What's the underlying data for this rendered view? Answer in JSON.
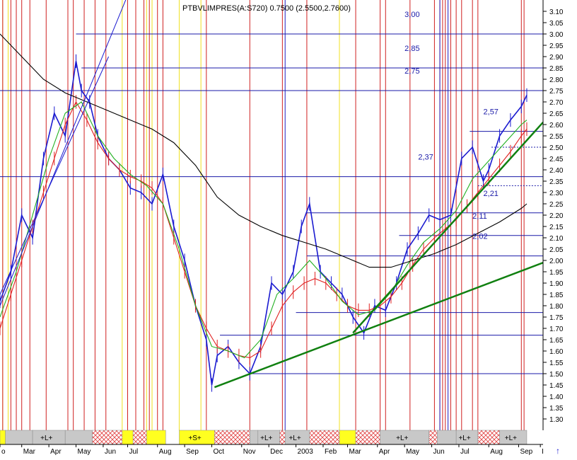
{
  "chart_data": {
    "type": "line",
    "title": "PTBVLIMPRES(A:S720) 0.7500 (2.5500,2.7600)",
    "y_ticks": [
      "3.10",
      "3.05",
      "3.00",
      "2.95",
      "2.90",
      "2.85",
      "2.80",
      "2.75",
      "2.70",
      "2.65",
      "2.60",
      "2.55",
      "2.50",
      "2.45",
      "2.40",
      "2.35",
      "2.30",
      "2.25",
      "2.20",
      "2.15",
      "2.10",
      "2.05",
      "2.00",
      "1.95",
      "1.90",
      "1.85",
      "1.80",
      "1.75",
      "1.70",
      "1.65",
      "1.60",
      "1.55",
      "1.50",
      "1.45",
      "1.40",
      "1.35",
      "1.30"
    ],
    "ylim": [
      1.25,
      3.15
    ],
    "x_range": [
      0,
      1.0
    ],
    "x_labels": [
      {
        "label": "o",
        "x": 0.0
      },
      {
        "label": "Mar",
        "x": 0.04
      },
      {
        "label": "Apr",
        "x": 0.09
      },
      {
        "label": "May",
        "x": 0.14
      },
      {
        "label": "Jun",
        "x": 0.19
      },
      {
        "label": "Jul",
        "x": 0.235
      },
      {
        "label": "Aug",
        "x": 0.29
      },
      {
        "label": "Sep",
        "x": 0.34
      },
      {
        "label": "Oct",
        "x": 0.39
      },
      {
        "label": "Nov",
        "x": 0.445
      },
      {
        "label": "Dec",
        "x": 0.495
      },
      {
        "label": "2003",
        "x": 0.545
      },
      {
        "label": "Feb",
        "x": 0.595
      },
      {
        "label": "Mar",
        "x": 0.64
      },
      {
        "label": "Apr",
        "x": 0.695
      },
      {
        "label": "May",
        "x": 0.745
      },
      {
        "label": "Jun",
        "x": 0.795
      },
      {
        "label": "Jul",
        "x": 0.845
      },
      {
        "label": "Aug",
        "x": 0.9
      },
      {
        "label": "Sep",
        "x": 0.955
      },
      {
        "label": "I",
        "x": 0.995
      }
    ],
    "price_levels": [
      {
        "label": "3,00",
        "y": 3.0,
        "x_from": 0.14,
        "label_x": 0.745
      },
      {
        "label": "2,85",
        "y": 2.85,
        "x_from": 0.15,
        "label_x": 0.745
      },
      {
        "label": "2,75",
        "y": 2.75,
        "x_from": 0.0,
        "label_x": 0.745
      },
      {
        "label": "2,57",
        "y": 2.57,
        "x_from": 0.865,
        "label_x": 0.89
      },
      {
        "label": "2,37",
        "y": 2.37,
        "x_from": 0.0,
        "label_x": 0.77
      },
      {
        "label": "2,21",
        "y": 2.21,
        "x_from": 0.565,
        "label_x": 0.89
      },
      {
        "label": "2,11",
        "y": 2.11,
        "x_from": 0.735,
        "label_x": 0.87
      },
      {
        "label": "2,02",
        "y": 2.02,
        "x_from": 0.565,
        "label_x": 0.87
      },
      {
        "label": "",
        "y": 1.77,
        "x_from": 0.545,
        "label_x": 0
      },
      {
        "label": "",
        "y": 1.67,
        "x_from": 0.405,
        "label_x": 0
      },
      {
        "label": "",
        "y": 1.5,
        "x_from": 0.46,
        "label_x": 0
      }
    ],
    "dotted_levels": [
      {
        "y": 2.5,
        "x_from": 0.905
      },
      {
        "y": 2.33,
        "x_from": 0.88
      }
    ],
    "trendlines": [
      {
        "name": "green-upper",
        "color": "#108010",
        "x1": 0.65,
        "y1": 1.68,
        "x2": 1.0,
        "y2": 2.61
      },
      {
        "name": "green-lower",
        "color": "#108010",
        "x1": 0.395,
        "y1": 1.44,
        "x2": 1.0,
        "y2": 1.99
      },
      {
        "name": "blue-steep-1",
        "color": "#1a1ad0",
        "x1": 0.0,
        "y1": 1.8,
        "x2": 0.24,
        "y2": 3.2
      },
      {
        "name": "blue-steep-2",
        "color": "#1a1ad0",
        "x1": 0.0,
        "y1": 1.85,
        "x2": 0.2,
        "y2": 2.9
      }
    ],
    "series": [
      {
        "name": "",
        "color": "#1a1ad0",
        "x": [
          0.0,
          0.02,
          0.04,
          0.06,
          0.08,
          0.1,
          0.12,
          0.14,
          0.15,
          0.165,
          0.18,
          0.2,
          0.22,
          0.24,
          0.26,
          0.28,
          0.3,
          0.32,
          0.34,
          0.36,
          0.38,
          0.39,
          0.4,
          0.42,
          0.44,
          0.46,
          0.48,
          0.5,
          0.52,
          0.54,
          0.555,
          0.57,
          0.59,
          0.61,
          0.63,
          0.65,
          0.67,
          0.69,
          0.71,
          0.73,
          0.75,
          0.77,
          0.79,
          0.81,
          0.83,
          0.85,
          0.87,
          0.89,
          0.9,
          0.92,
          0.94,
          0.96,
          0.97
        ],
        "y": [
          1.82,
          1.95,
          2.2,
          2.1,
          2.45,
          2.65,
          2.55,
          2.88,
          2.75,
          2.7,
          2.55,
          2.45,
          2.4,
          2.32,
          2.3,
          2.25,
          2.38,
          2.15,
          2.0,
          1.8,
          1.65,
          1.45,
          1.58,
          1.62,
          1.55,
          1.5,
          1.62,
          1.9,
          1.85,
          1.95,
          2.15,
          2.25,
          1.95,
          1.9,
          1.85,
          1.75,
          1.68,
          1.8,
          1.78,
          1.9,
          2.05,
          2.12,
          2.2,
          2.18,
          2.2,
          2.45,
          2.5,
          2.35,
          2.4,
          2.55,
          2.62,
          2.68,
          2.73
        ]
      },
      {
        "name": "",
        "color": "#e02020",
        "x": [
          0.0,
          0.02,
          0.04,
          0.06,
          0.08,
          0.1,
          0.12,
          0.14,
          0.16,
          0.18,
          0.2,
          0.22,
          0.24,
          0.26,
          0.28,
          0.3,
          0.32,
          0.34,
          0.36,
          0.38,
          0.4,
          0.42,
          0.44,
          0.46,
          0.48,
          0.5,
          0.52,
          0.54,
          0.56,
          0.58,
          0.6,
          0.62,
          0.64,
          0.66,
          0.68,
          0.7,
          0.72,
          0.74,
          0.76,
          0.78,
          0.8,
          0.82,
          0.84,
          0.86,
          0.88,
          0.9,
          0.92,
          0.94,
          0.96,
          0.97
        ],
        "y": [
          1.7,
          1.85,
          2.0,
          2.15,
          2.3,
          2.45,
          2.6,
          2.7,
          2.62,
          2.52,
          2.45,
          2.4,
          2.37,
          2.35,
          2.32,
          2.25,
          2.1,
          1.95,
          1.8,
          1.7,
          1.62,
          1.6,
          1.58,
          1.57,
          1.6,
          1.7,
          1.8,
          1.86,
          1.9,
          1.92,
          1.9,
          1.85,
          1.8,
          1.78,
          1.78,
          1.8,
          1.84,
          1.9,
          1.98,
          2.05,
          2.1,
          2.14,
          2.18,
          2.24,
          2.3,
          2.36,
          2.42,
          2.48,
          2.55,
          2.58
        ]
      },
      {
        "name": "",
        "color": "#20b020",
        "x": [
          0.0,
          0.03,
          0.06,
          0.09,
          0.12,
          0.15,
          0.18,
          0.21,
          0.24,
          0.27,
          0.3,
          0.33,
          0.36,
          0.39,
          0.42,
          0.45,
          0.48,
          0.51,
          0.54,
          0.57,
          0.6,
          0.63,
          0.66,
          0.69,
          0.72,
          0.75,
          0.78,
          0.81,
          0.84,
          0.87,
          0.9,
          0.93,
          0.96,
          0.97
        ],
        "y": [
          1.75,
          1.95,
          2.2,
          2.45,
          2.65,
          2.7,
          2.55,
          2.45,
          2.38,
          2.33,
          2.25,
          2.05,
          1.8,
          1.62,
          1.6,
          1.57,
          1.65,
          1.85,
          1.92,
          2.0,
          1.92,
          1.82,
          1.76,
          1.78,
          1.86,
          1.98,
          2.08,
          2.14,
          2.22,
          2.36,
          2.44,
          2.52,
          2.6,
          2.62
        ]
      },
      {
        "name": "",
        "color": "#000000",
        "x": [
          0.0,
          0.04,
          0.08,
          0.12,
          0.16,
          0.2,
          0.24,
          0.28,
          0.32,
          0.36,
          0.4,
          0.44,
          0.48,
          0.52,
          0.56,
          0.6,
          0.64,
          0.68,
          0.72,
          0.76,
          0.8,
          0.84,
          0.88,
          0.92,
          0.96,
          0.97
        ],
        "y": [
          3.0,
          2.9,
          2.8,
          2.74,
          2.7,
          2.66,
          2.62,
          2.58,
          2.52,
          2.42,
          2.28,
          2.2,
          2.15,
          2.11,
          2.08,
          2.05,
          2.01,
          1.97,
          1.97,
          2.0,
          2.03,
          2.07,
          2.12,
          2.17,
          2.23,
          2.25
        ]
      }
    ],
    "red_vlines": [
      0.005,
      0.02,
      0.03,
      0.04,
      0.055,
      0.085,
      0.125,
      0.135,
      0.155,
      0.175,
      0.195,
      0.235,
      0.25,
      0.265,
      0.275,
      0.29,
      0.3,
      0.38,
      0.46,
      0.52,
      0.565,
      0.655,
      0.7,
      0.71,
      0.755,
      0.8,
      0.81,
      0.815,
      0.82,
      0.83,
      0.84,
      0.85,
      0.87,
      0.88,
      0.96,
      0.965
    ],
    "yellow_vlines": [
      0.005,
      0.015,
      0.225,
      0.27,
      0.28,
      0.33,
      0.37,
      0.625
    ],
    "blue_vlines": [
      0.525,
      0.81,
      0.825
    ],
    "indicator_bar": {
      "segments": [
        {
          "kind": "yellow",
          "from": 0.0,
          "to": 0.01
        },
        {
          "kind": "gray",
          "from": 0.01,
          "to": 0.06
        },
        {
          "kind": "gray",
          "from": 0.06,
          "to": 0.12,
          "label": "+L+"
        },
        {
          "kind": "gray",
          "from": 0.12,
          "to": 0.17
        },
        {
          "kind": "hatch",
          "from": 0.17,
          "to": 0.225
        },
        {
          "kind": "yellow",
          "from": 0.225,
          "to": 0.245
        },
        {
          "kind": "hatch",
          "from": 0.245,
          "to": 0.27
        },
        {
          "kind": "yellow",
          "from": 0.27,
          "to": 0.305
        },
        {
          "kind": "yellow",
          "from": 0.33,
          "to": 0.395,
          "label": "+S+"
        },
        {
          "kind": "hatch",
          "from": 0.395,
          "to": 0.46
        },
        {
          "kind": "gray",
          "from": 0.46,
          "to": 0.475
        },
        {
          "kind": "gray",
          "from": 0.475,
          "to": 0.515,
          "label": "+L+"
        },
        {
          "kind": "hatch",
          "from": 0.515,
          "to": 0.525
        },
        {
          "kind": "gray",
          "from": 0.525,
          "to": 0.57,
          "label": "+L+"
        },
        {
          "kind": "hatch",
          "from": 0.57,
          "to": 0.625
        },
        {
          "kind": "yellow",
          "from": 0.625,
          "to": 0.655
        },
        {
          "kind": "hatch",
          "from": 0.655,
          "to": 0.7
        },
        {
          "kind": "gray",
          "from": 0.7,
          "to": 0.79,
          "label": "+L+"
        },
        {
          "kind": "hatch",
          "from": 0.79,
          "to": 0.805
        },
        {
          "kind": "gray",
          "from": 0.805,
          "to": 0.84
        },
        {
          "kind": "gray",
          "from": 0.84,
          "to": 0.88,
          "label": "+L+"
        },
        {
          "kind": "hatch",
          "from": 0.88,
          "to": 0.92
        },
        {
          "kind": "gray",
          "from": 0.92,
          "to": 0.97,
          "label": "+L+"
        }
      ]
    },
    "scroll_arrow": "↑"
  }
}
